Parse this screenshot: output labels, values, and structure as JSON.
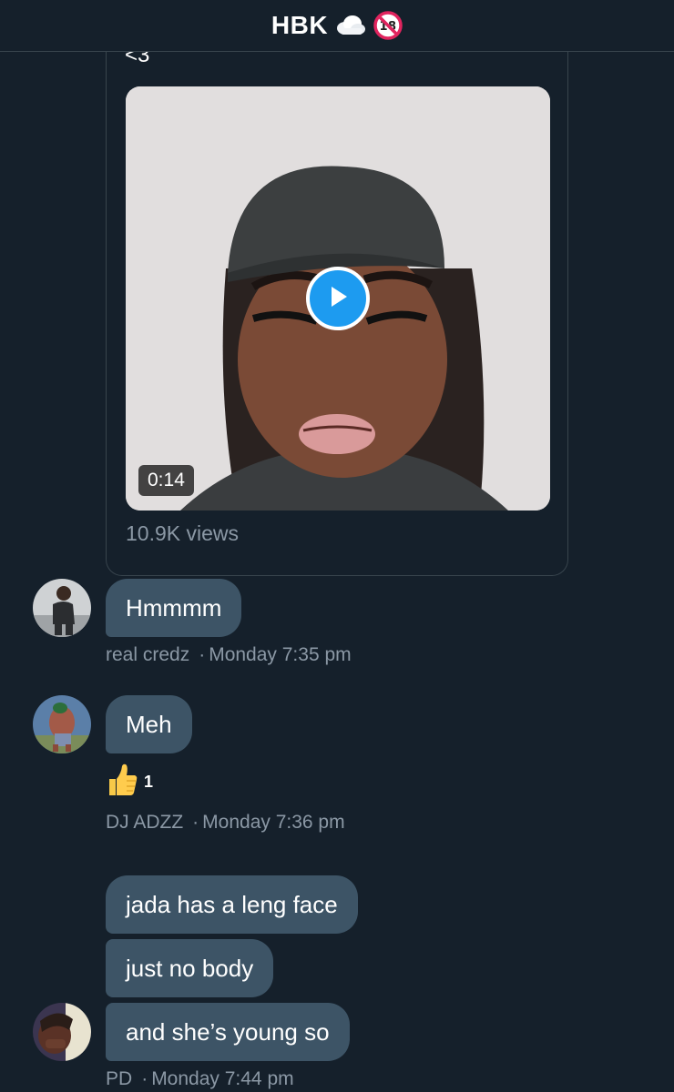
{
  "header": {
    "title": "HBK",
    "cloud_emoji": "cloud-icon",
    "adult_emoji": "no-under-18-icon"
  },
  "shared_tweet": {
    "text": "<3",
    "video_duration": "0:14",
    "views": "10.9K views"
  },
  "messages": [
    {
      "text": "Hmmmm",
      "sender": "real credz",
      "time": "Monday 7:35 pm"
    },
    {
      "text": "Meh",
      "reaction_emoji": "thumbs-up-icon",
      "reaction_count": "1",
      "sender": "DJ ADZZ",
      "time": "Monday 7:36 pm"
    },
    {
      "texts": [
        "jada has a leng face",
        "just no body",
        "and she’s young so"
      ],
      "sender": "PD",
      "time": "Monday 7:44 pm"
    }
  ],
  "meta_separator": "·",
  "colors": {
    "background": "#15202b",
    "bubble": "#3d5466",
    "meta_text": "#8b98a5",
    "accent": "#1d9bf0"
  }
}
